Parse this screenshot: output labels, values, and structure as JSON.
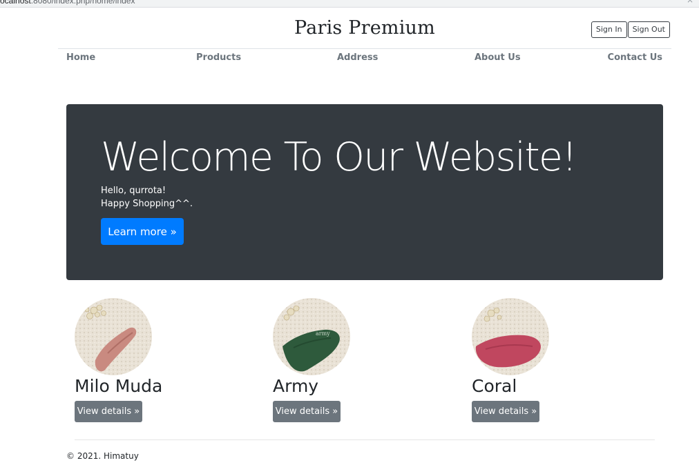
{
  "browser": {
    "url_prefix": "ocalhost",
    "url_rest": ":8080/index.php/home/index",
    "close_glyph": "×"
  },
  "header": {
    "brand": "Paris Premium",
    "sign_in": "Sign In",
    "sign_out": "Sign Out"
  },
  "nav": {
    "home": "Home",
    "products": "Products",
    "address": "Address",
    "about": "About Us",
    "contact": "Contact Us"
  },
  "hero": {
    "title": "Welcome To Our Website!",
    "line1": "Hello, qurrota!",
    "line2": "Happy Shopping^^.",
    "button": "Learn more »",
    "bg_color": "#343a40",
    "button_color": "#007bff"
  },
  "products": [
    {
      "name": "Milo Muda",
      "button": "View details »",
      "fabric_color": "#c98a80"
    },
    {
      "name": "Army",
      "button": "View details »",
      "fabric_color": "#2e5a3c",
      "fabric_text": "army"
    },
    {
      "name": "Coral",
      "button": "View details »",
      "fabric_color": "#c0475f"
    }
  ],
  "footer": {
    "text": "© 2021. Himatuy"
  }
}
